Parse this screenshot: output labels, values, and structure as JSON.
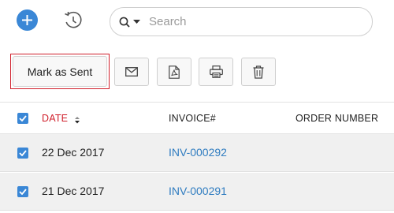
{
  "topbar": {
    "add_icon": "plus-icon",
    "recent_icon": "history-clock-icon",
    "search": {
      "placeholder": "Search",
      "scope_icon": "search-icon",
      "dropdown_icon": "caret-down-icon"
    }
  },
  "toolbar": {
    "mark_as_sent_label": "Mark as Sent",
    "actions": [
      {
        "name": "email",
        "icon": "mail-icon"
      },
      {
        "name": "pdf",
        "icon": "pdf-icon"
      },
      {
        "name": "print",
        "icon": "printer-icon"
      },
      {
        "name": "delete",
        "icon": "trash-icon"
      }
    ]
  },
  "table": {
    "columns": [
      "DATE",
      "INVOICE#",
      "ORDER NUMBER"
    ],
    "sort_icon": "sort-arrows-icon",
    "rows": [
      {
        "date": "22 Dec 2017",
        "invoice": "INV-000292",
        "order_number": ""
      },
      {
        "date": "21 Dec 2017",
        "invoice": "INV-000291",
        "order_number": ""
      }
    ]
  },
  "colors": {
    "accent": "#3a87d6",
    "highlight": "#d01f2b",
    "link": "#2f7cc0"
  }
}
